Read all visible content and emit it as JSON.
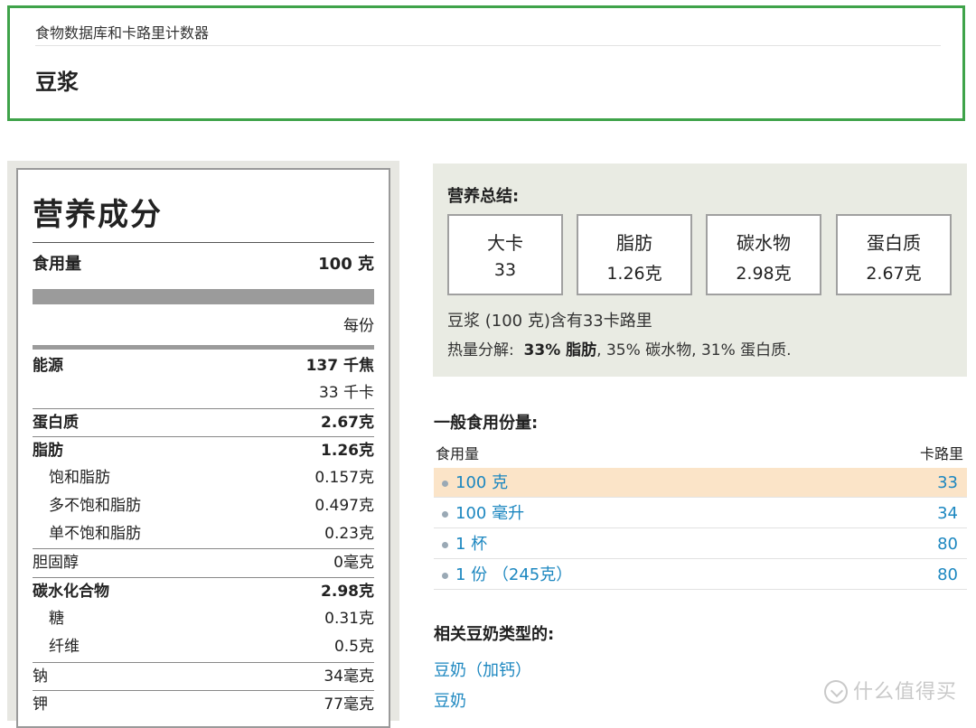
{
  "header": {
    "breadcrumb": "食物数据库和卡路里计数器",
    "title": "豆浆"
  },
  "nutrition": {
    "title": "营养成分",
    "serving_label": "食用量",
    "serving_value": "100 克",
    "per_serving": "每份",
    "rows": [
      {
        "label": "能源",
        "value": "137 千焦",
        "bold": true
      },
      {
        "label": "",
        "value": "33 千卡"
      },
      {
        "label": "蛋白质",
        "value": "2.67克",
        "bold": true
      },
      {
        "label": "脂肪",
        "value": "1.26克",
        "bold": true
      },
      {
        "label": "饱和脂肪",
        "value": "0.157克",
        "indent": true
      },
      {
        "label": "多不饱和脂肪",
        "value": "0.497克",
        "indent": true
      },
      {
        "label": "单不饱和脂肪",
        "value": "0.23克",
        "indent": true
      },
      {
        "label": "胆固醇",
        "value": "0毫克"
      },
      {
        "label": "碳水化合物",
        "value": "2.98克",
        "bold": true
      },
      {
        "label": "糖",
        "value": "0.31克",
        "indent": true
      },
      {
        "label": "纤维",
        "value": "0.5克",
        "indent": true
      },
      {
        "label": "钠",
        "value": "34毫克"
      },
      {
        "label": "钾",
        "value": "77毫克"
      }
    ]
  },
  "summary": {
    "title": "营养总结:",
    "boxes": [
      {
        "label": "大卡",
        "value": "33"
      },
      {
        "label": "脂肪",
        "value": "1.26克"
      },
      {
        "label": "碳水物",
        "value": "2.98克"
      },
      {
        "label": "蛋白质",
        "value": "2.67克"
      }
    ],
    "calorie_line": "豆浆 (100 克)含有33卡路里",
    "breakdown_prefix": "热量分解:",
    "breakdown_fat": "33% 脂肪",
    "breakdown_rest": ", 35% 碳水物, 31% 蛋白质."
  },
  "common": {
    "title": "一般食用份量:",
    "col_serving": "食用量",
    "col_calories": "卡路里",
    "rows": [
      {
        "serving": "100 克",
        "calories": "33"
      },
      {
        "serving": "100 毫升",
        "calories": "34"
      },
      {
        "serving": "1 杯",
        "calories": "80"
      },
      {
        "serving": "1 份 （245克）",
        "calories": "80"
      }
    ]
  },
  "related": {
    "title": "相关豆奶类型的:",
    "links": [
      "豆奶（加钙）",
      "豆奶"
    ]
  },
  "watermark": "什么值得买",
  "colors": {
    "header_border": "#3fa34a",
    "link": "#1c87c0",
    "highlight": "#fbe4c8",
    "summary_bg": "#e9ebe3"
  }
}
